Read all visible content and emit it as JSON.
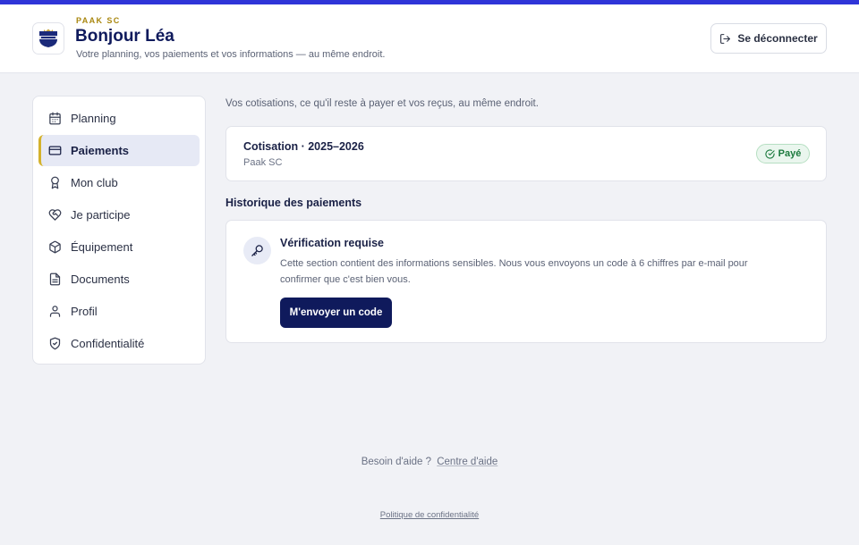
{
  "header": {
    "club_name": "PAAK SC",
    "greeting": "Bonjour Léa",
    "subtitle": "Votre planning, vos paiements et vos informations — au même endroit.",
    "logout_label": "Se déconnecter"
  },
  "sidebar": {
    "items": [
      {
        "label": "Planning",
        "icon": "calendar-icon"
      },
      {
        "label": "Paiements",
        "icon": "credit-card-icon",
        "active": true
      },
      {
        "label": "Mon club",
        "icon": "award-icon"
      },
      {
        "label": "Je participe",
        "icon": "heart-handshake-icon"
      },
      {
        "label": "Équipement",
        "icon": "box-icon"
      },
      {
        "label": "Documents",
        "icon": "document-icon"
      },
      {
        "label": "Profil",
        "icon": "user-icon"
      },
      {
        "label": "Confidentialité",
        "icon": "shield-check-icon"
      }
    ]
  },
  "main": {
    "intro": "Vos cotisations, ce qu'il reste à payer et vos reçus, au même endroit.",
    "cotisation": {
      "title": "Cotisation · 2025–2026",
      "club": "Paak SC",
      "status": "Payé"
    },
    "history_title": "Historique des paiements",
    "verification": {
      "title": "Vérification requise",
      "text": "Cette section contient des informations sensibles. Nous vous envoyons un code à 6 chiffres par e-mail pour confirmer que c'est bien vous.",
      "button": "M'envoyer un code"
    }
  },
  "footer": {
    "help_text": "Besoin d'aide ?",
    "help_link": "Centre d'aide",
    "privacy_link": "Politique de confidentialité"
  },
  "colors": {
    "accent_top_bar": "#2f35d8",
    "primary_navy": "#0f1a5c",
    "active_marker": "#d4b22c",
    "success_green": "#1c7a3e"
  }
}
